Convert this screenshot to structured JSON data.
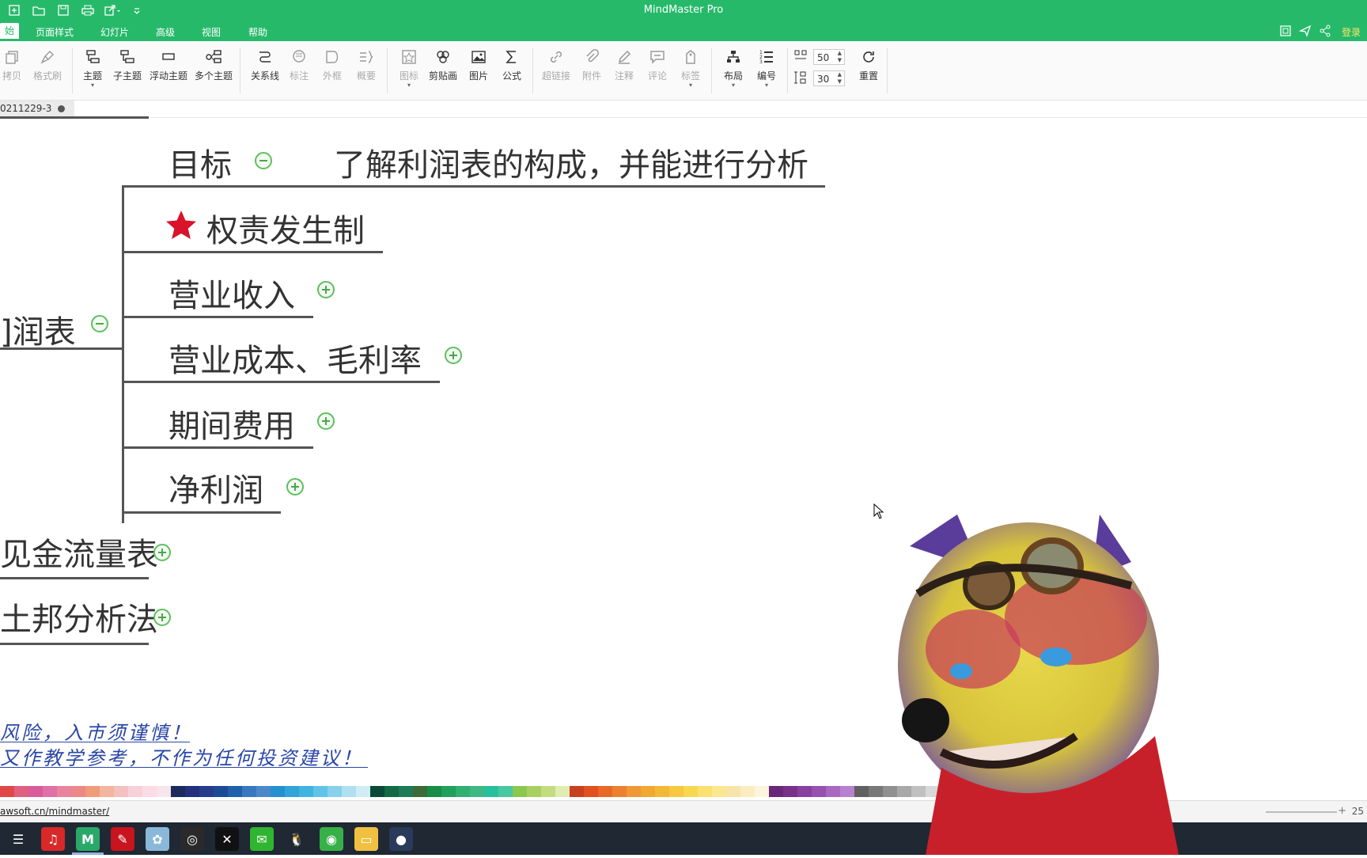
{
  "window": {
    "title": "MindMaster Pro"
  },
  "menu": {
    "items": [
      "始",
      "页面样式",
      "幻灯片",
      "高级",
      "视图",
      "帮助"
    ],
    "login": "登录"
  },
  "ribbon": {
    "buttons": [
      "拷贝",
      "格式刷",
      "主题",
      "子主题",
      "浮动主题",
      "多个主题",
      "关系线",
      "标注",
      "外框",
      "概要",
      "图标",
      "剪贴画",
      "图片",
      "公式",
      "超链接",
      "附件",
      "注释",
      "评论",
      "标签",
      "布局",
      "编号",
      "重置"
    ],
    "spin_h": "50",
    "spin_v": "30"
  },
  "tab": {
    "name": "0211229-3"
  },
  "mindmap": {
    "goal_label": "目标",
    "goal_text": "了解利润表的构成，并能进行分析",
    "root_partial": "]润表",
    "children": [
      "权责发生制",
      "营业收入",
      "营业成本、毛利率",
      "期间费用",
      "净利润"
    ],
    "siblings": [
      "见金流量表",
      "土邦分析法"
    ]
  },
  "notes": {
    "line1": "风险，入市须谨慎！",
    "line2": "又作教学参考，不作为任何投资建议！"
  },
  "palette": [
    "#e04848",
    "#e06080",
    "#d85c9c",
    "#e070a8",
    "#e8849c",
    "#ec8888",
    "#f09c78",
    "#f4b4a0",
    "#f4c0c0",
    "#f8d0d8",
    "#fcdce4",
    "#f8e4ec",
    "#1c2a5c",
    "#24307c",
    "#283c8c",
    "#1c4a94",
    "#2060a8",
    "#3878c0",
    "#4c88cc",
    "#2490d0",
    "#30a4d8",
    "#40b4e0",
    "#60c4e8",
    "#88d0ec",
    "#b0e0f0",
    "#d0ecf4",
    "#0c4a38",
    "#146a44",
    "#1c7c58",
    "#3c6c38",
    "#188c48",
    "#20a05c",
    "#30b070",
    "#40b884",
    "#28c09c",
    "#48c8a0",
    "#8cc850",
    "#a8d060",
    "#c4dc80",
    "#e0ecb0",
    "#c84020",
    "#e05020",
    "#e86828",
    "#ec8030",
    "#f09838",
    "#f0a830",
    "#f4b838",
    "#f8c840",
    "#f8d850",
    "#fce070",
    "#fce890",
    "#f8e4a8",
    "#fcecc0",
    "#fcf4dc",
    "#682878",
    "#783088",
    "#8840a0",
    "#9850b0",
    "#a868c0",
    "#b880d0",
    "#606060",
    "#787878",
    "#909090",
    "#a8a8a8",
    "#c0c0c0",
    "#d8d8d8",
    "#ececec"
  ],
  "status": {
    "link": "awsoft.cn/mindmaster/",
    "zoom": "25"
  },
  "taskbar": {
    "icons": [
      "task-view-icon",
      "netease-music-icon",
      "mindmaster-icon",
      "app-red-icon",
      "app-flower-icon",
      "obs-icon",
      "capcut-icon",
      "wechat-icon",
      "qq-icon",
      "browser-icon",
      "file-explorer-icon",
      "app-dark-icon"
    ]
  }
}
